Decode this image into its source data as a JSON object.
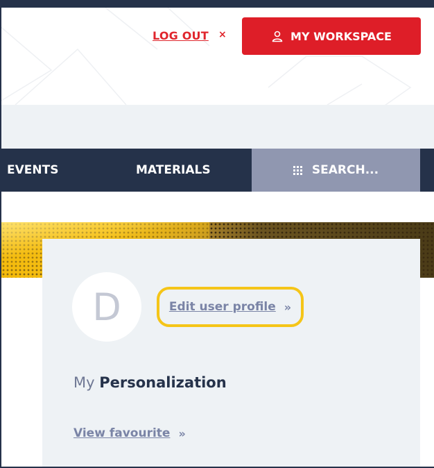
{
  "header": {
    "logout_label": "LOG OUT",
    "logout_x": "×",
    "workspace_label": "MY WORKSPACE",
    "workspace_icon": "user-icon"
  },
  "nav": {
    "items": [
      {
        "label": "EVENTS"
      },
      {
        "label": "MATERIALS"
      }
    ],
    "search_label": "SEARCH...",
    "search_icon": "grid-icon"
  },
  "profile": {
    "avatar_letter": "D",
    "edit_link": "Edit user profile",
    "chevron": "»",
    "section_pre": "My",
    "section_main": "Personalization",
    "favourite_link": "View favourite"
  },
  "colors": {
    "brand_red": "#de1e28",
    "navy": "#25324a",
    "search_bg": "#9097b0",
    "highlight": "#f5c518"
  }
}
